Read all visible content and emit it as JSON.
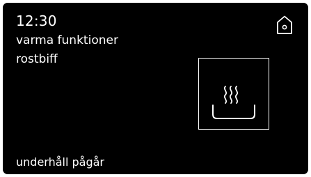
{
  "header": {
    "time": "12:30",
    "mode": "varma funktioner",
    "program": "rostbiff"
  },
  "nav": {
    "home_icon": "home-icon"
  },
  "function_tile": {
    "icon": "steam-dish-icon"
  },
  "footer": {
    "status": "underhåll pågår"
  },
  "colors": {
    "background": "#000000",
    "foreground": "#ffffff"
  }
}
